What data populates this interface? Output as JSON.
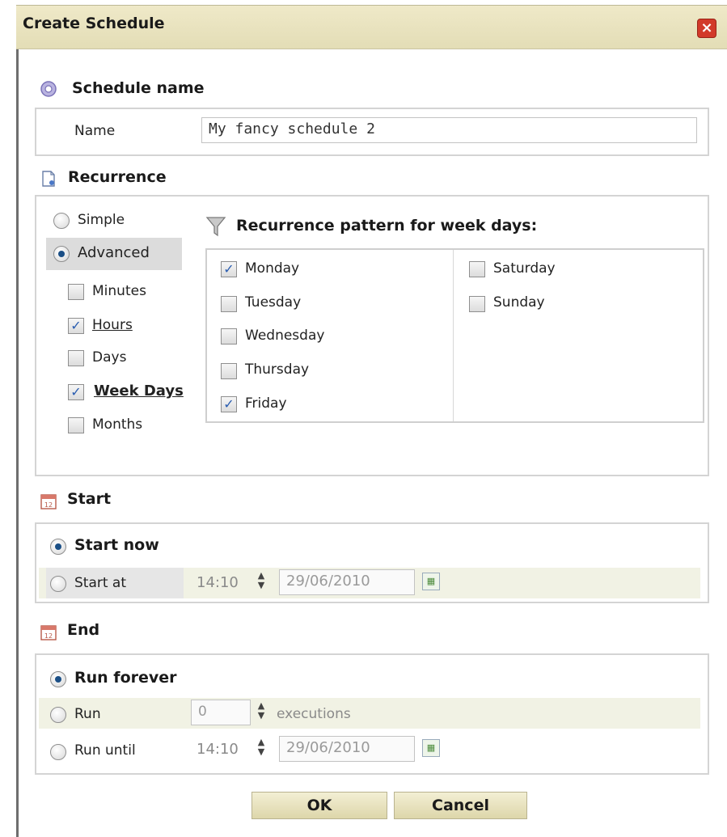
{
  "dialog": {
    "title": "Create Schedule",
    "close_icon": "close-icon"
  },
  "schedule_name": {
    "section_title": "Schedule name",
    "icon": "gear-icon",
    "name_label": "Name",
    "name_value": "My fancy schedule 2"
  },
  "recurrence": {
    "section_title": "Recurrence",
    "icon": "document-icon",
    "mode_simple": "Simple",
    "mode_advanced": "Advanced",
    "selected_mode": "Advanced",
    "units": [
      {
        "label": "Minutes",
        "checked": false,
        "style": "normal"
      },
      {
        "label": "Hours",
        "checked": true,
        "style": "underline"
      },
      {
        "label": "Days",
        "checked": false,
        "style": "normal"
      },
      {
        "label": "Week Days",
        "checked": true,
        "style": "bold-underline"
      },
      {
        "label": "Months",
        "checked": false,
        "style": "normal"
      }
    ],
    "pattern_title": "Recurrence pattern for week days:",
    "pattern_icon": "filter-icon",
    "weekdays_col1": [
      {
        "label": "Monday",
        "checked": true
      },
      {
        "label": "Tuesday",
        "checked": false
      },
      {
        "label": "Wednesday",
        "checked": false
      },
      {
        "label": "Thursday",
        "checked": false
      },
      {
        "label": "Friday",
        "checked": true
      }
    ],
    "weekdays_col2": [
      {
        "label": "Saturday",
        "checked": false
      },
      {
        "label": "Sunday",
        "checked": false
      }
    ]
  },
  "start": {
    "section_title": "Start",
    "icon": "calendar-icon",
    "start_now": "Start now",
    "start_at": "Start at",
    "time": "14:10",
    "date": "29/06/2010"
  },
  "end": {
    "section_title": "End",
    "icon": "calendar-icon",
    "run_forever": "Run forever",
    "run": "Run",
    "executions_value": "0",
    "executions_label": "executions",
    "run_until": "Run until",
    "time": "14:10",
    "date": "29/06/2010"
  },
  "buttons": {
    "ok": "OK",
    "cancel": "Cancel"
  }
}
